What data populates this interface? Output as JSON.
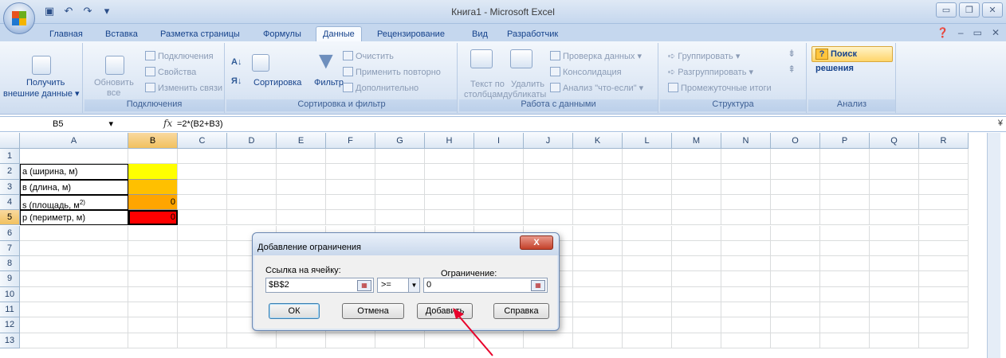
{
  "window": {
    "title": "Книга1 - Microsoft Excel",
    "controls": [
      "▭",
      "❐",
      "✕"
    ]
  },
  "tabs": [
    "Главная",
    "Вставка",
    "Разметка страницы",
    "Формулы",
    "Данные",
    "Рецензирование",
    "Вид",
    "Разработчик"
  ],
  "active_tab": "Данные",
  "ribbon": {
    "external": {
      "label1": "Получить",
      "label2": "внешние данные",
      "dropdown": "▾"
    },
    "connections": {
      "refresh1": "Обновить",
      "refresh2": "все",
      "connections": "Подключения",
      "properties": "Свойства",
      "edit_links": "Изменить связи",
      "group_label": "Подключения"
    },
    "sort": {
      "sort_btn": "Сортировка",
      "filter_btn": "Фильтр",
      "clear": "Очистить",
      "reapply": "Применить повторно",
      "advanced": "Дополнительно",
      "group_label": "Сортировка и фильтр"
    },
    "data_tools": {
      "text_to_cols1": "Текст по",
      "text_to_cols2": "столбцам",
      "remove_dup1": "Удалить",
      "remove_dup2": "дубликаты",
      "validation": "Проверка данных",
      "consolidate": "Консолидация",
      "whatif": "Анализ \"что-если\"",
      "group_label": "Работа с данными"
    },
    "outline": {
      "group": "Группировать",
      "ungroup": "Разгруппировать",
      "subtotal": "Промежуточные итоги",
      "group_label": "Структура"
    },
    "analysis": {
      "solver": "Поиск решения",
      "solver_icon": "?",
      "group_label": "Анализ"
    }
  },
  "formula_bar": {
    "name_box": "B5",
    "fx": "fx",
    "formula": "=2*(B2+B3)"
  },
  "columns": [
    "A",
    "B",
    "C",
    "D",
    "E",
    "F",
    "G",
    "H",
    "I",
    "J",
    "K",
    "L",
    "M",
    "N",
    "O",
    "P",
    "Q",
    "R"
  ],
  "rows": [
    "1",
    "2",
    "3",
    "4",
    "5",
    "6",
    "7",
    "8",
    "9",
    "10",
    "11",
    "12",
    "13"
  ],
  "cells": {
    "A2": "a (ширина, м)",
    "A3": "в (длина, м)",
    "A4": "s (площадь, м",
    "A4_sup": "2)",
    "A5": "p (периметр, м)",
    "B4": "0",
    "B5": "0"
  },
  "cell_colors": {
    "B2": "#ffff00",
    "B3": "#ffc000",
    "B4": "#ffa500",
    "B5": "#ff0000"
  },
  "dialog": {
    "title": "Добавление ограничения",
    "close": "X",
    "cell_ref_label": "Ссылка на ячейку:",
    "cell_ref_value": "$B$2",
    "operator": ">=",
    "constraint_label": "Ограничение:",
    "constraint_value": "0",
    "ok": "ОК",
    "cancel": "Отмена",
    "add": "Добавить",
    "help": "Справка"
  },
  "annotation_color": "#e8002a"
}
